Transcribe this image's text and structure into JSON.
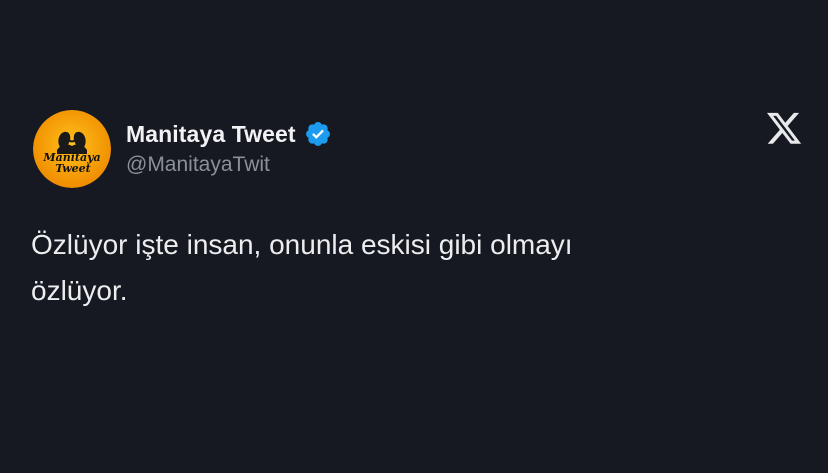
{
  "tweet": {
    "author": {
      "display_name": "Manitaya Tweet",
      "handle": "@ManitayaTwit",
      "verified": true,
      "avatar_text_line1": "Manitaya",
      "avatar_text_line2": "Tweet"
    },
    "text_line1": "Özlüyor işte insan, onunla eskisi gibi olmayı",
    "text_line2": "özlüyor.",
    "icons": {
      "verified": "verified-badge-icon",
      "platform": "x-logo-icon"
    }
  },
  "colors": {
    "background": "#161922",
    "verified_badge": "#1d9bf0",
    "avatar_orange": "#f5a300",
    "text_primary": "#ecedee",
    "text_secondary": "#8a9098"
  }
}
